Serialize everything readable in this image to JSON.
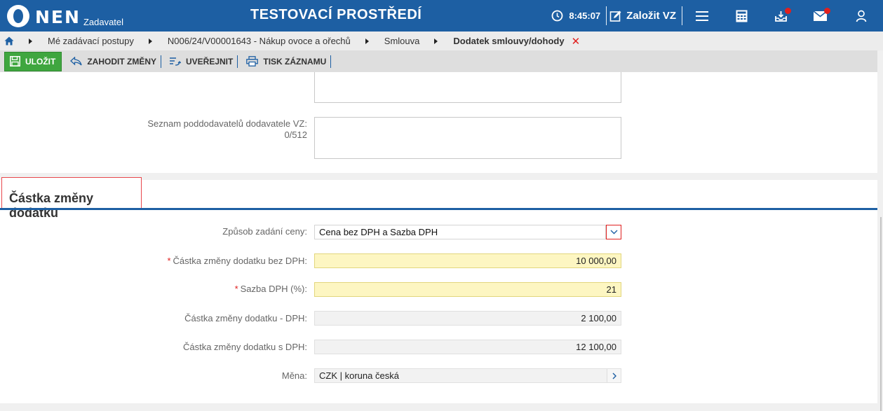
{
  "header": {
    "logo_text": "NEN",
    "logo_sub": "Zadavatel",
    "env_title": "TESTOVACÍ PROSTŘEDÍ",
    "time": "8:45:07",
    "create_label": "Založit VZ"
  },
  "breadcrumb": {
    "items": [
      "Mé zadávací postupy",
      "N006/24/V00001643 - Nákup ovoce a ořechů",
      "Smlouva"
    ],
    "current": "Dodatek smlouvy/dohody",
    "close_glyph": "✕"
  },
  "toolbar": {
    "save_label": "ULOŽIT",
    "discard_label": "ZAHODIT ZMĚNY",
    "publish_label": "UVEŘEJNIT",
    "print_label": "TISK ZÁZNAMU"
  },
  "panel_top": {
    "subcontractors_label": "Seznam poddodavatelů dodavatele VZ:",
    "subcontractors_counter": "0/512"
  },
  "section": {
    "title": "Částka změny dodatku",
    "fields": {
      "method_label": "Způsob zadání ceny:",
      "method_value": "Cena bez DPH a Sazba DPH",
      "amount_label": "Částka změny dodatku bez DPH:",
      "amount_value": "10 000,00",
      "vat_rate_label": "Sazba DPH (%):",
      "vat_rate_value": "21",
      "vat_label": "Částka změny dodatku - DPH:",
      "vat_value": "2 100,00",
      "total_label": "Částka změny dodatku s DPH:",
      "total_value": "12 100,00",
      "currency_label": "Měna:",
      "currency_value": "CZK | koruna česká"
    }
  },
  "colors": {
    "brand": "#1d5fa3",
    "save": "#3fa63f",
    "required": "#e0201f",
    "input_yellow": "#fdf6c2"
  }
}
